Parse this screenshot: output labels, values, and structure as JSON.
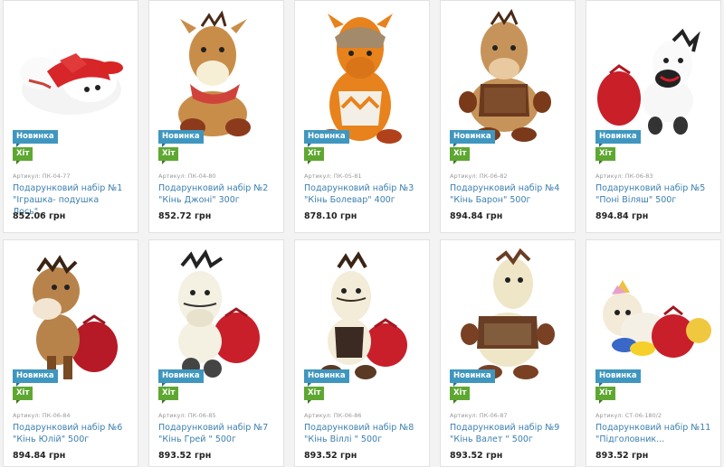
{
  "badges": {
    "new": "Новинка",
    "hit": "Хіт"
  },
  "products": [
    {
      "sku": "Артикул: ПК-04-77",
      "name": "Подарунковий набір №1 \"Іграшка- подушка Лось\"...",
      "price": "852.06 грн",
      "image": "moose-pillow-plush",
      "color": "#e02a2a"
    },
    {
      "sku": "Артикул: ПК-04-80",
      "name": "Подарунковий набір №2 \"Кінь Джоні\" 300г",
      "price": "852.72 грн",
      "image": "horse-johnny-plush",
      "color": "#c98d4a"
    },
    {
      "sku": "Артикул: ПК-05-81",
      "name": "Подарунковий набір №3 \"Кінь Болевар\" 400г",
      "price": "878.10 грн",
      "image": "horse-bolevar-plush",
      "color": "#e8821c"
    },
    {
      "sku": "Артикул: ПК-06-82",
      "name": "Подарунковий набір №4 \"Кінь Барон\" 500г",
      "price": "894.84 грн",
      "image": "horse-baron-plush",
      "color": "#c6945a"
    },
    {
      "sku": "Артикул: ПК-06-83",
      "name": "Подарунковий набір №5 \"Поні Віляш\" 500г",
      "price": "894.84 грн",
      "image": "pony-vilyash-plush",
      "color": "#f2f2f2"
    },
    {
      "sku": "Артикул: ПК-06-84",
      "name": "Подарунковий набір №6 \"Кінь Юлій\" 500г",
      "price": "894.84 грн",
      "image": "horse-yuliy-plush",
      "color": "#b8834a"
    },
    {
      "sku": "Артикул: ПК-06-85",
      "name": "Подарунковий набір №7 \"Кінь Грей \" 500г",
      "price": "893.52 грн",
      "image": "horse-grey-plush",
      "color": "#f4f1e2"
    },
    {
      "sku": "Артикул: ПК-06-86",
      "name": "Подарунковий набір №8 \"Кінь Віллі \" 500г",
      "price": "893.52 грн",
      "image": "horse-willy-plush",
      "color": "#f2ecd8"
    },
    {
      "sku": "Артикул: ПК-06-87",
      "name": "Подарунковий набір №9 \"Кінь Валет \" 500г",
      "price": "893.52 грн",
      "image": "horse-valet-plush",
      "color": "#efe6c8"
    },
    {
      "sku": "Артикул: СТ-06-180/2",
      "name": "Подарунковий набір №11 \"Підголовник...",
      "price": "893.52 грн",
      "image": "unicorn-headrest-plush",
      "color": "#f5f0e6"
    }
  ]
}
